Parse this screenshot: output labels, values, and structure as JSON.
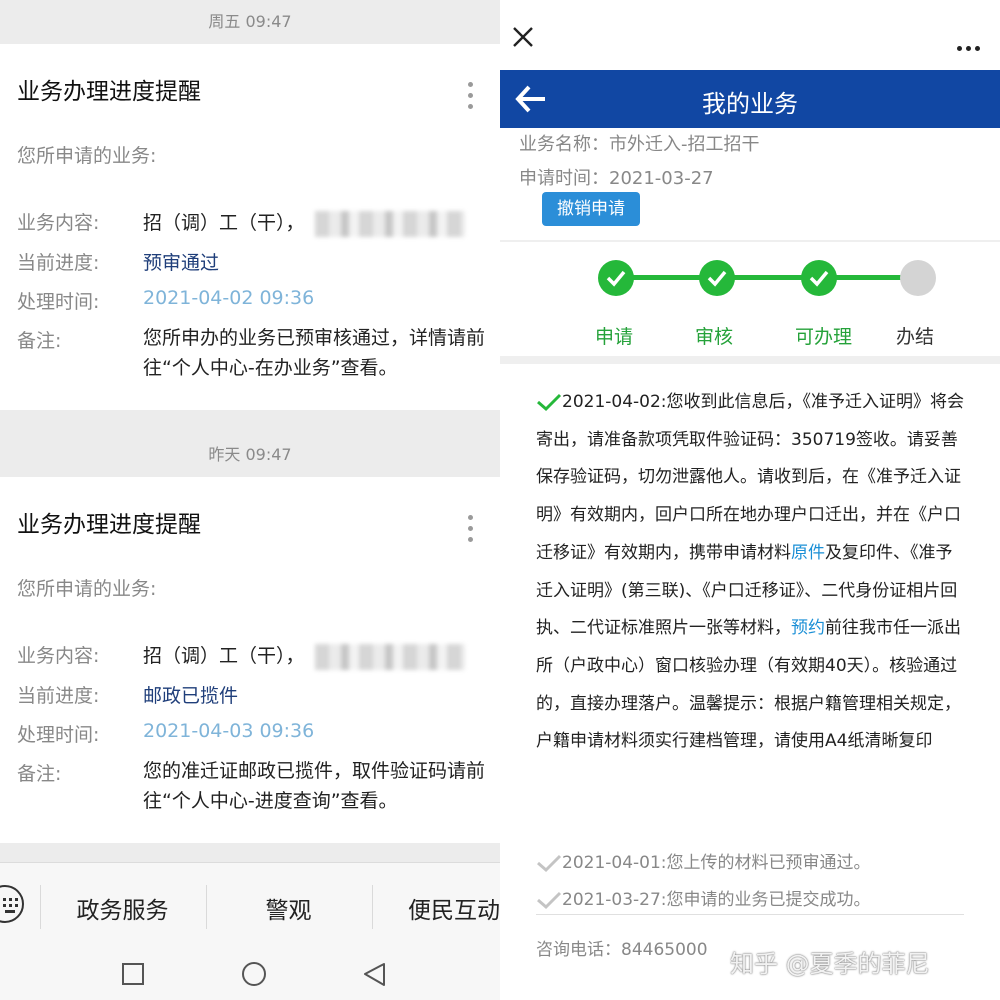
{
  "left": {
    "msg1": {
      "time": "周五 09:47",
      "title": "业务办理进度提醒",
      "subtitle": "您所申请的业务:",
      "content_label": "业务内容:",
      "content_value": "招（调）工（干），",
      "progress_label": "当前进度:",
      "progress_value": "预审通过",
      "time_label": "处理时间:",
      "time_value": "2021-04-02 09:36",
      "note_label": "备注:",
      "note_value": "您所申办的业务已预审核通过，详情请前往“个人中心-在办业务”查看。"
    },
    "msg2": {
      "time": "昨天 09:47",
      "title": "业务办理进度提醒",
      "subtitle": "您所申请的业务:",
      "content_label": "业务内容:",
      "content_value": "招（调）工（干），",
      "progress_label": "当前进度:",
      "progress_value": "邮政已揽件",
      "time_label": "处理时间:",
      "time_value": "2021-04-03 09:36",
      "note_label": "备注:",
      "note_value": "您的准迁证邮政已揽件，取件验证码请前往“个人中心-进度查询”查看。"
    },
    "menu": [
      "政务服务",
      "警观",
      "便民互动"
    ],
    "icons": [
      "keyboard-icon",
      "square-icon",
      "circle-icon",
      "triangle-back-icon"
    ]
  },
  "right": {
    "header_title": "我的业务",
    "business_name": "业务名称：市外迁入-招工招干",
    "apply_time": "申请时间：2021-03-27",
    "cancel_label": "撤销申请",
    "steps": [
      {
        "label": "申请",
        "done": true
      },
      {
        "label": "审核",
        "done": true
      },
      {
        "label": "可办理",
        "done": true
      },
      {
        "label": "办结",
        "done": false
      }
    ],
    "detail": {
      "part1": "2021-04-02:您收到此信息后，《准予迁入证明》将会寄出，请准备款项凭取件验证码：350719签收。请妥善保存验证码，切勿泄露他人。请收到后，在《准予迁入证明》有效期内，回户口所在地办理户口迁出，并在《户口迁移证》有效期内，携带申请材料",
      "hl1": "原件",
      "part2": "及复印件、《准予迁入证明》(第三联)、《户口迁移证》、二代身份证相片回执、二代证标准照片一张等材料，",
      "hl2": "预约",
      "part3": "前往我市任一派出所（户政中心）窗口核验办理（有效期40天）。核验通过的，直接办理落户。温馨提示：根据户籍管理相关规定，户籍申请材料须实行建档管理，请使用A4纸清晰复印"
    },
    "history": [
      "2021-04-01:您上传的材料已预审通过。",
      "2021-03-27:您申请的业务已提交成功。"
    ],
    "phone": "咨询电话：84465000",
    "watermark": "知乎 @夏季的菲尼",
    "colors": {
      "header": "#1147a3",
      "step_green": "#25b83a",
      "highlight": "#1a8fd6"
    }
  }
}
